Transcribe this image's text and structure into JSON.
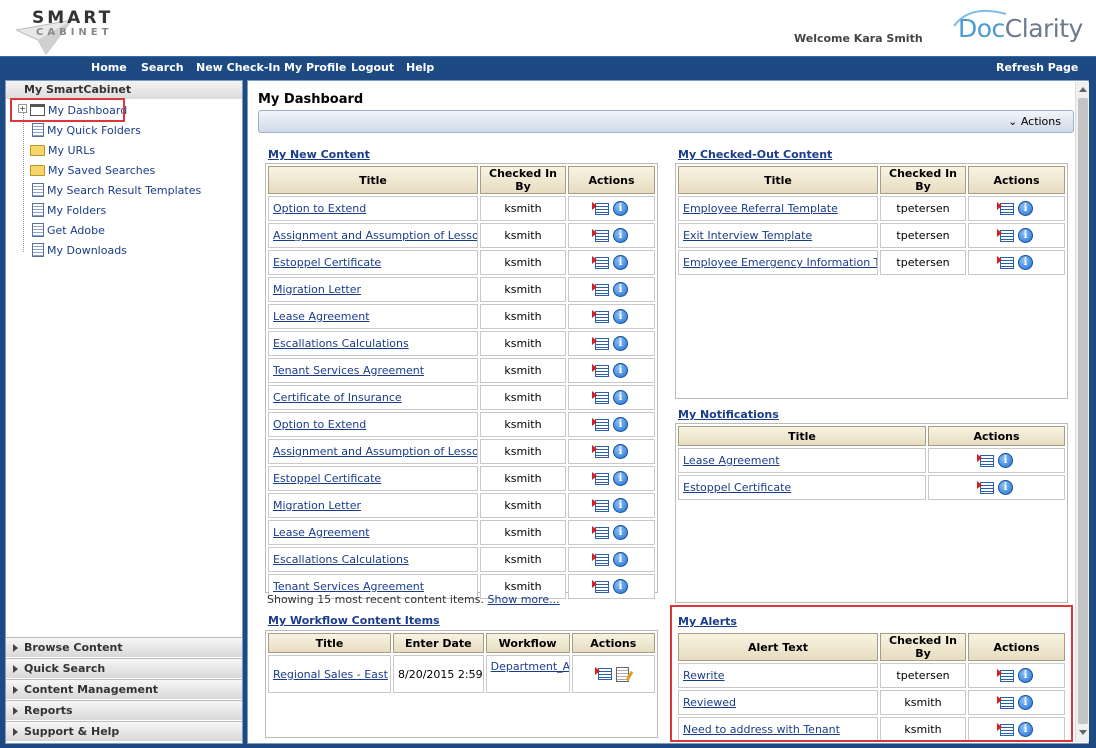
{
  "header": {
    "logo_top": "SMART",
    "logo_bottom": "CABINET",
    "welcome": "Welcome Kara Smith",
    "brand_doc": "Doc",
    "brand_clarity": "Clarity"
  },
  "nav": {
    "home": "Home",
    "search": "Search",
    "new_checkin": "New Check-In",
    "profile": "My Profile",
    "logout": "Logout",
    "help": "Help",
    "refresh": "Refresh Page"
  },
  "sidebar": {
    "title": "My SmartCabinet",
    "items": [
      {
        "label": "My Dashboard",
        "icon": "window-icon"
      },
      {
        "label": "My Quick Folders",
        "icon": "page-icon"
      },
      {
        "label": "My URLs",
        "icon": "folder-icon"
      },
      {
        "label": "My Saved Searches",
        "icon": "folder-icon"
      },
      {
        "label": "My Search Result Templates",
        "icon": "page-icon"
      },
      {
        "label": "My Folders",
        "icon": "page-icon"
      },
      {
        "label": "Get Adobe",
        "icon": "page-icon"
      },
      {
        "label": "My Downloads",
        "icon": "page-icon"
      }
    ],
    "accordions": [
      "Browse Content",
      "Quick Search",
      "Content Management",
      "Reports",
      "Support & Help"
    ]
  },
  "main": {
    "title": "My Dashboard",
    "actions_label": "Actions"
  },
  "new_content": {
    "title": "My New Content",
    "headers": [
      "Title",
      "Checked In By",
      "Actions"
    ],
    "rows": [
      {
        "title": "Option to Extend",
        "by": "ksmith"
      },
      {
        "title": "Assignment and Assumption of Lessors Interest",
        "by": "ksmith"
      },
      {
        "title": "Estoppel Certificate",
        "by": "ksmith"
      },
      {
        "title": "Migration Letter",
        "by": "ksmith"
      },
      {
        "title": "Lease Agreement",
        "by": "ksmith"
      },
      {
        "title": "Escallations Calculations",
        "by": "ksmith"
      },
      {
        "title": "Tenant Services Agreement",
        "by": "ksmith"
      },
      {
        "title": "Certificate of Insurance",
        "by": "ksmith"
      },
      {
        "title": "Option to Extend",
        "by": "ksmith"
      },
      {
        "title": "Assignment and Assumption of Lessors Interest",
        "by": "ksmith"
      },
      {
        "title": "Estoppel Certificate",
        "by": "ksmith"
      },
      {
        "title": "Migration Letter",
        "by": "ksmith"
      },
      {
        "title": "Lease Agreement",
        "by": "ksmith"
      },
      {
        "title": "Escallations Calculations",
        "by": "ksmith"
      },
      {
        "title": "Tenant Services Agreement",
        "by": "ksmith"
      }
    ],
    "showing_text": "Showing 15 most recent content items.",
    "show_more": "Show more..."
  },
  "workflow": {
    "title": "My Workflow Content Items",
    "headers": [
      "Title",
      "Enter Date",
      "Workflow",
      "Actions"
    ],
    "rows": [
      {
        "title": "Regional Sales - East",
        "date": "8/20/2015 2:59",
        "workflow": "Department_Approval"
      }
    ]
  },
  "checked_out": {
    "title": "My Checked-Out Content",
    "headers": [
      "Title",
      "Checked In By",
      "Actions"
    ],
    "rows": [
      {
        "title": "Employee Referral Template",
        "by": "tpetersen"
      },
      {
        "title": "Exit Interview Template",
        "by": "tpetersen"
      },
      {
        "title": "Employee Emergency Information Template",
        "by": "tpetersen"
      }
    ]
  },
  "notifications": {
    "title": "My Notifications",
    "headers": [
      "Title",
      "Actions"
    ],
    "rows": [
      {
        "title": "Lease Agreement"
      },
      {
        "title": "Estoppel Certificate"
      }
    ]
  },
  "alerts": {
    "title": "My Alerts",
    "headers": [
      "Alert Text",
      "Checked In By",
      "Actions"
    ],
    "rows": [
      {
        "title": "Rewrite",
        "by": "tpetersen"
      },
      {
        "title": "Reviewed",
        "by": "ksmith"
      },
      {
        "title": "Need to address with Tenant",
        "by": "ksmith"
      }
    ]
  },
  "colors": {
    "nav_bg": "#1e4a84",
    "link": "#1a3d8a",
    "highlight": "#d9373a"
  }
}
